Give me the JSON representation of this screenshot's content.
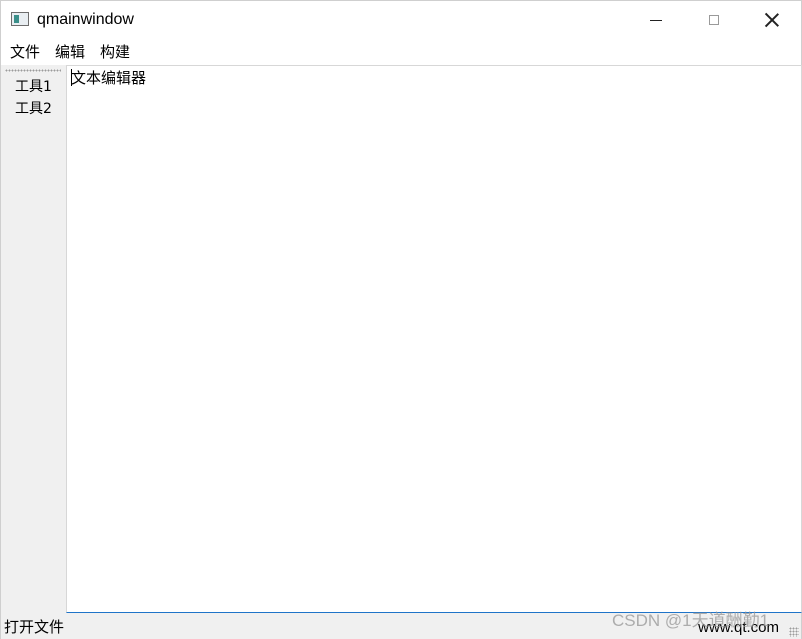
{
  "window": {
    "title": "qmainwindow",
    "controls": {
      "minimize_icon": "minimize-icon",
      "maximize_icon": "maximize-icon",
      "close_icon": "close-icon"
    }
  },
  "menubar": {
    "items": [
      {
        "label": "文件"
      },
      {
        "label": "编辑"
      },
      {
        "label": "构建"
      }
    ]
  },
  "toolbar": {
    "items": [
      {
        "label": "工具1"
      },
      {
        "label": "工具2"
      }
    ]
  },
  "editor": {
    "text": "文本编辑器"
  },
  "statusbar": {
    "left": "打开文件",
    "right": "www.qt.com"
  },
  "watermark": "CSDN @1天道酬勤1",
  "colors": {
    "focus_border": "#1f74c8",
    "toolbar_bg": "#f0f0f0"
  }
}
